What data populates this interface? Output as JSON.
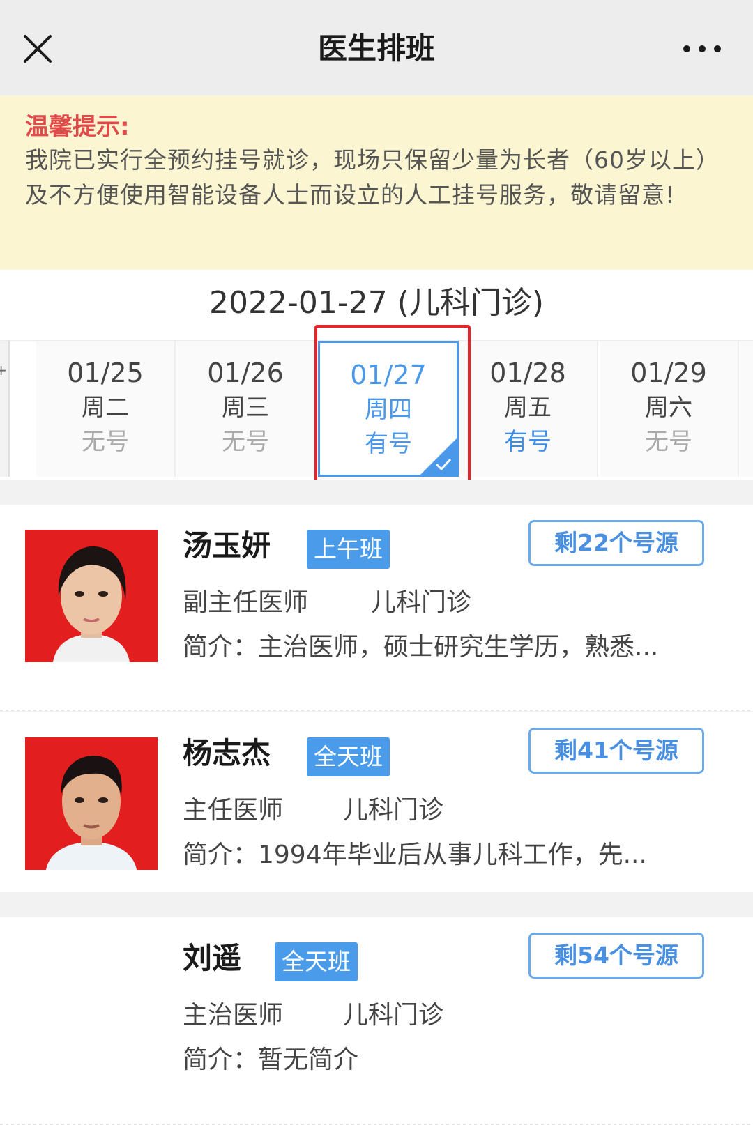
{
  "header": {
    "title": "医生排班",
    "close_icon": "close-icon",
    "more_icon": "more-icon"
  },
  "notice": {
    "title": "温馨提示:",
    "text": "我院已实行全预约挂号就诊，现场只保留少量为长者（60岁以上）及不方便使用智能设备人士而设立的人工挂号服务，敬请留意!"
  },
  "schedule": {
    "heading": "2022-01-27 (儿科门诊)",
    "dates": [
      {
        "date": "01/25",
        "weekday": "周二",
        "status": "无号",
        "available": false,
        "selected": false
      },
      {
        "date": "01/26",
        "weekday": "周三",
        "status": "无号",
        "available": false,
        "selected": false
      },
      {
        "date": "01/27",
        "weekday": "周四",
        "status": "有号",
        "available": true,
        "selected": true
      },
      {
        "date": "01/28",
        "weekday": "周五",
        "status": "有号",
        "available": true,
        "selected": false
      },
      {
        "date": "01/29",
        "weekday": "周六",
        "status": "无号",
        "available": false,
        "selected": false
      }
    ]
  },
  "doctors": [
    {
      "name": "汤玉妍",
      "shift": "上午班",
      "remaining": "剩22个号源",
      "title": "副主任医师",
      "dept": "儿科门诊",
      "intro": "简介：主治医师，硕士研究生学历，熟悉...",
      "has_photo": true
    },
    {
      "name": "杨志杰",
      "shift": "全天班",
      "remaining": "剩41个号源",
      "title": "主任医师",
      "dept": "儿科门诊",
      "intro": "简介：1994年毕业后从事儿科工作，先...",
      "has_photo": true
    },
    {
      "name": "刘遥",
      "shift": "全天班",
      "remaining": "剩54个号源",
      "title": "主治医师",
      "dept": "儿科门诊",
      "intro": "简介：暂无简介",
      "has_photo": false
    }
  ],
  "colors": {
    "accent": "#4a98ea",
    "notice_bg": "#fbf5d1",
    "notice_title": "#e04a4a",
    "highlight_frame": "#e8232a",
    "photo_bg": "#e21e1e"
  }
}
